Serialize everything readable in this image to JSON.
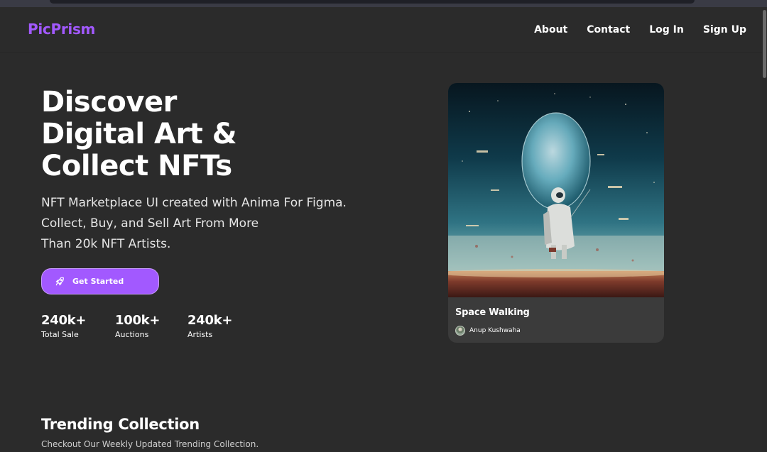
{
  "nav": {
    "logo": "PicPrism",
    "links": [
      "About",
      "Contact",
      "Log In",
      "Sign Up"
    ]
  },
  "hero": {
    "title_lines": [
      "Discover",
      "Digital Art &",
      "Collect NFTs"
    ],
    "subtitle_lines": [
      "NFT Marketplace UI created with Anima For Figma.",
      "Collect, Buy, and Sell Art From More",
      "Than 20k NFT Artists."
    ],
    "cta_label": "Get Started",
    "cta_icon": "rocket-icon",
    "stats": [
      {
        "value": "240k+",
        "label": "Total Sale"
      },
      {
        "value": "100k+",
        "label": "Auctions"
      },
      {
        "value": "240k+",
        "label": "Artists"
      }
    ]
  },
  "featured_card": {
    "title": "Space Walking",
    "artist": "Anup Kushwaha"
  },
  "trending": {
    "title": "Trending Collection",
    "subtitle": "Checkout Our Weekly Updated Trending Collection."
  },
  "colors": {
    "accent": "#a259ff",
    "background": "#2b2b2b",
    "card": "#3b3b3b"
  }
}
